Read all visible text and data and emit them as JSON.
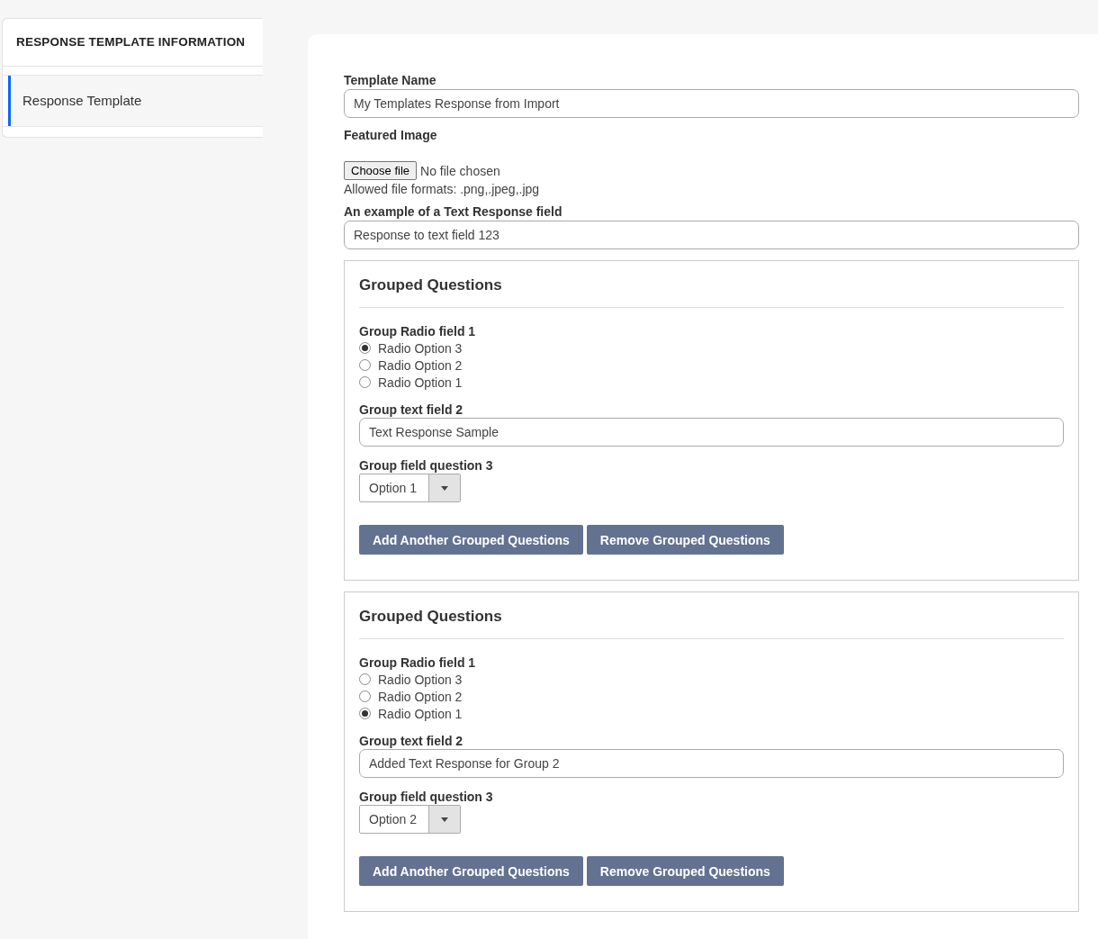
{
  "sidebar": {
    "title": "RESPONSE TEMPLATE INFORMATION",
    "items": [
      {
        "label": "Response Template",
        "selected": true
      }
    ]
  },
  "form": {
    "template_name": {
      "label": "Template Name",
      "value": "My Templates Response from Import"
    },
    "featured_image": {
      "label": "Featured Image",
      "button": "Choose file",
      "status": "No file chosen",
      "hint": "Allowed file formats: .png,.jpeg,.jpg"
    },
    "text_response": {
      "label": "An example of a Text Response field",
      "value": "Response to text field 123"
    },
    "groups": [
      {
        "title": "Grouped Questions",
        "radio_label": "Group Radio field 1",
        "radios": [
          {
            "label": "Radio Option 3",
            "selected": true
          },
          {
            "label": "Radio Option 2",
            "selected": false
          },
          {
            "label": "Radio Option 1",
            "selected": false
          }
        ],
        "text_label": "Group text field 2",
        "text_value": "Text Response Sample",
        "select_label": "Group field question 3",
        "select_value": "Option 1",
        "buttons": [
          "Add Another Grouped Questions",
          "Remove Grouped Questions"
        ]
      },
      {
        "title": "Grouped Questions",
        "radio_label": "Group Radio field 1",
        "radios": [
          {
            "label": "Radio Option 3",
            "selected": false
          },
          {
            "label": "Radio Option 2",
            "selected": false
          },
          {
            "label": "Radio Option 1",
            "selected": true
          }
        ],
        "text_label": "Group text field 2",
        "text_value": "Added Text Response for Group 2",
        "select_label": "Group field question 3",
        "select_value": "Option 2",
        "buttons": [
          "Add Another Grouped Questions",
          "Remove Grouped Questions"
        ]
      }
    ]
  }
}
